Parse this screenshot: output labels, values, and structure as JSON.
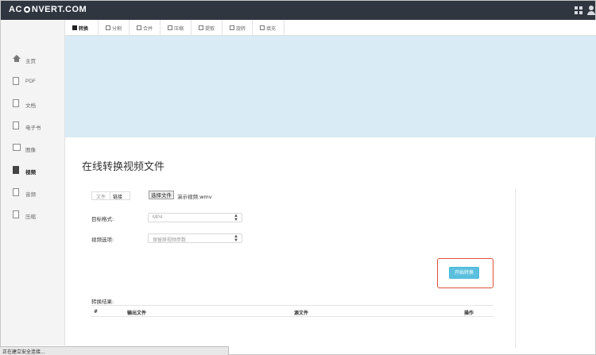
{
  "header": {
    "logo_left": "AC",
    "logo_right": "NVERT.COM",
    "icons": [
      "grid-icon",
      "user-icon"
    ]
  },
  "sidebar": {
    "items": [
      {
        "label": "主页",
        "icon": "home-icon"
      },
      {
        "label": "PDF",
        "icon": "pdf-file-icon"
      },
      {
        "label": "文档",
        "icon": "document-icon"
      },
      {
        "label": "电子书",
        "icon": "ebook-icon"
      },
      {
        "label": "图像",
        "icon": "image-icon"
      },
      {
        "label": "视频",
        "icon": "video-icon",
        "active": true
      },
      {
        "label": "音频",
        "icon": "audio-icon"
      },
      {
        "label": "压缩",
        "icon": "archive-icon"
      }
    ]
  },
  "tabs": [
    {
      "label": "转换",
      "active": true
    },
    {
      "label": "分割"
    },
    {
      "label": "合并"
    },
    {
      "label": "压缩"
    },
    {
      "label": "提取"
    },
    {
      "label": "旋转"
    },
    {
      "label": "填充"
    }
  ],
  "main": {
    "title": "在线转换视频文件",
    "source_tabs": {
      "file": "文件",
      "link": "链接"
    },
    "choose_file_label": "选择文件",
    "file_name": "演示视频.wmv",
    "target_format_label": "目标格式:",
    "target_format_value": "MP4",
    "video_options_label": "视频选项:",
    "video_options_value": "保留原视频参数",
    "start_button": "开始转换",
    "results_label": "转换结果:",
    "results_columns": [
      "#",
      "输出文件",
      "源文件",
      "操作"
    ]
  },
  "status_bar": "正在建立安全连接...",
  "colors": {
    "topbar": "#2f3640",
    "banner": "#d9ebf5",
    "start_button": "#5bc0de",
    "highlight": "#e0503a"
  }
}
